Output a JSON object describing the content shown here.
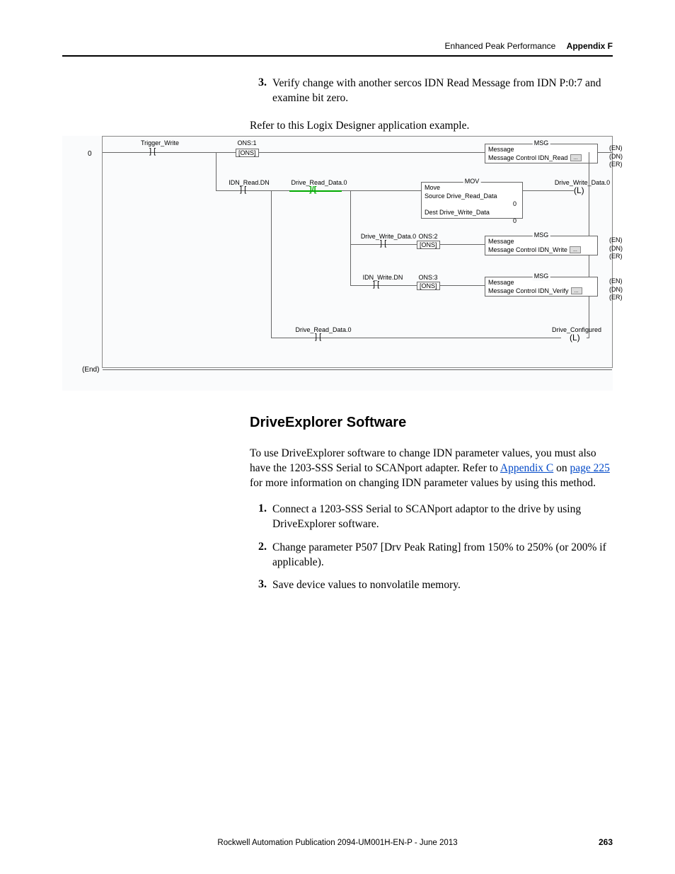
{
  "header": {
    "section": "Enhanced Peak Performance",
    "appendix": "Appendix F"
  },
  "intro": {
    "step3_num": "3.",
    "step3_text": "Verify change with another sercos IDN Read Message from IDN P:0:7 and examine bit zero.",
    "refer": "Refer to this Logix Designer application example."
  },
  "diagram": {
    "rung0": "0",
    "end": "(End)",
    "trigger_write": "Trigger_Write",
    "ons1": "ONS:1",
    "ons1_tag": "[ONS]",
    "msg1_title": "MSG",
    "msg1_l1": "Message",
    "msg1_l2": "Message Control  IDN_Read",
    "en": "(EN)",
    "dn": "(DN)",
    "er": "(ER)",
    "idn_read_dn": "IDN_Read.DN",
    "drive_read_data0": "Drive_Read_Data.0",
    "mov_title": "MOV",
    "mov_l1": "Move",
    "mov_l2": "Source  Drive_Read_Data",
    "mov_l2v": "0",
    "mov_l3": "Dest     Drive_Write_Data",
    "mov_l3v": "0",
    "drive_write_data0": "Drive_Write_Data.0",
    "coil_l": "(L)",
    "ons2": "ONS:2",
    "ons2_tag": "[ONS]",
    "msg2_title": "MSG",
    "msg2_l1": "Message",
    "msg2_l2": "Message Control  IDN_Write",
    "idn_write_dn": "IDN_Write.DN",
    "ons3": "ONS:3",
    "ons3_tag": "[ONS]",
    "msg3_title": "MSG",
    "msg3_l1": "Message",
    "msg3_l2": "Message Control  IDN_Verify",
    "drive_configured": "Drive_Configured",
    "ellipsis": "..."
  },
  "section2": {
    "heading": "DriveExplorer Software",
    "para_part1": "To use DriveExplorer software to change IDN parameter values, you must also have the 1203-SSS Serial to SCANport adapter. Refer to ",
    "link1": "Appendix C",
    "para_part2": " on ",
    "link2": "page 225",
    "para_part3": " for more information on changing IDN parameter values by using this method.",
    "s1_num": "1.",
    "s1": "Connect a 1203-SSS Serial to SCANport adaptor to the drive by using DriveExplorer software.",
    "s2_num": "2.",
    "s2": "Change parameter P507 [Drv Peak Rating] from 150% to 250% (or 200% if applicable).",
    "s3_num": "3.",
    "s3": "Save device values to nonvolatile memory."
  },
  "footer": {
    "pub": "Rockwell Automation Publication 2094-UM001H-EN-P - June 2013",
    "page": "263"
  }
}
